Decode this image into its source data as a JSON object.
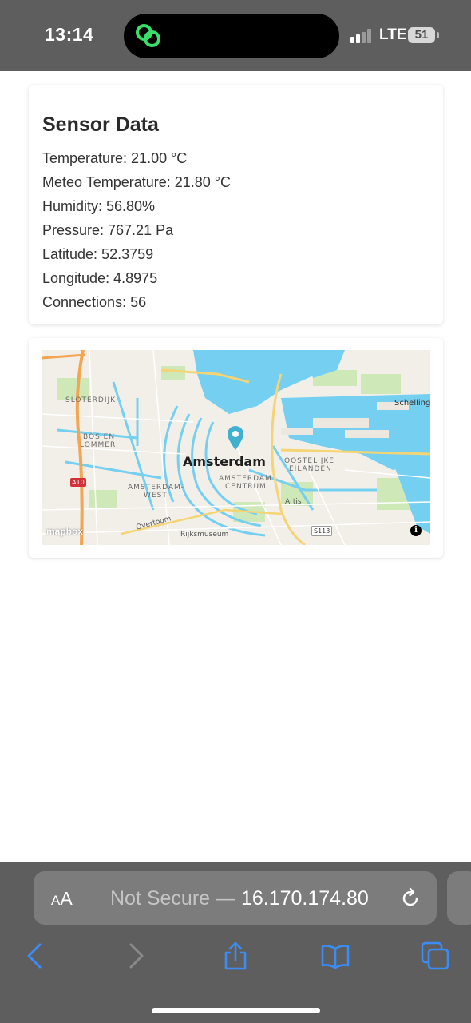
{
  "status_bar": {
    "time": "13:14",
    "network": "LTE",
    "battery": "51"
  },
  "sensor_card": {
    "title": "Sensor Data",
    "readings": [
      "Temperature: 21.00 °C",
      "Meteo Temperature: 21.80 °C",
      "Humidity: 56.80%",
      "Pressure: 767.21 Pa",
      "Latitude: 52.3759",
      "Longitude: 4.8975",
      "Connections: 56"
    ]
  },
  "map": {
    "city_label": "Amsterdam",
    "labels": {
      "sloterdijk": "SLOTERDIJK",
      "bos_en_lommer_1": "BOS EN",
      "bos_en_lommer_2": "LOMMER",
      "schelling": "Schelling",
      "oostelijke_1": "OOSTELIJKE",
      "oostelijke_2": "EILANDEN",
      "centrum_1": "AMSTERDAM",
      "centrum_2": "CENTRUM",
      "west_1": "AMSTERDAM-",
      "west_2": "WEST",
      "artis": "Artis",
      "overtoom": "Overtoom",
      "rijksmuseum": "Rijksmuseum",
      "a10": "A10",
      "s113": "S113"
    },
    "attribution": "mapbox",
    "colors": {
      "water": "#75cff0",
      "land": "#f2efe9",
      "park": "#cfe8b8",
      "road_major": "#f3a552",
      "road_secondary": "#f4d474",
      "marker": "#3fb1ce"
    }
  },
  "browser": {
    "aa_label_big": "A",
    "aa_label_small": "A",
    "url_prefix": "Not Secure — ",
    "url_host": "16.170.174.80"
  },
  "icons": [
    "island-app-icon",
    "signal-icon",
    "battery-icon",
    "map-marker-icon",
    "info-icon",
    "reload-icon",
    "back-icon",
    "forward-icon",
    "share-icon",
    "bookmarks-icon",
    "tabs-icon"
  ]
}
